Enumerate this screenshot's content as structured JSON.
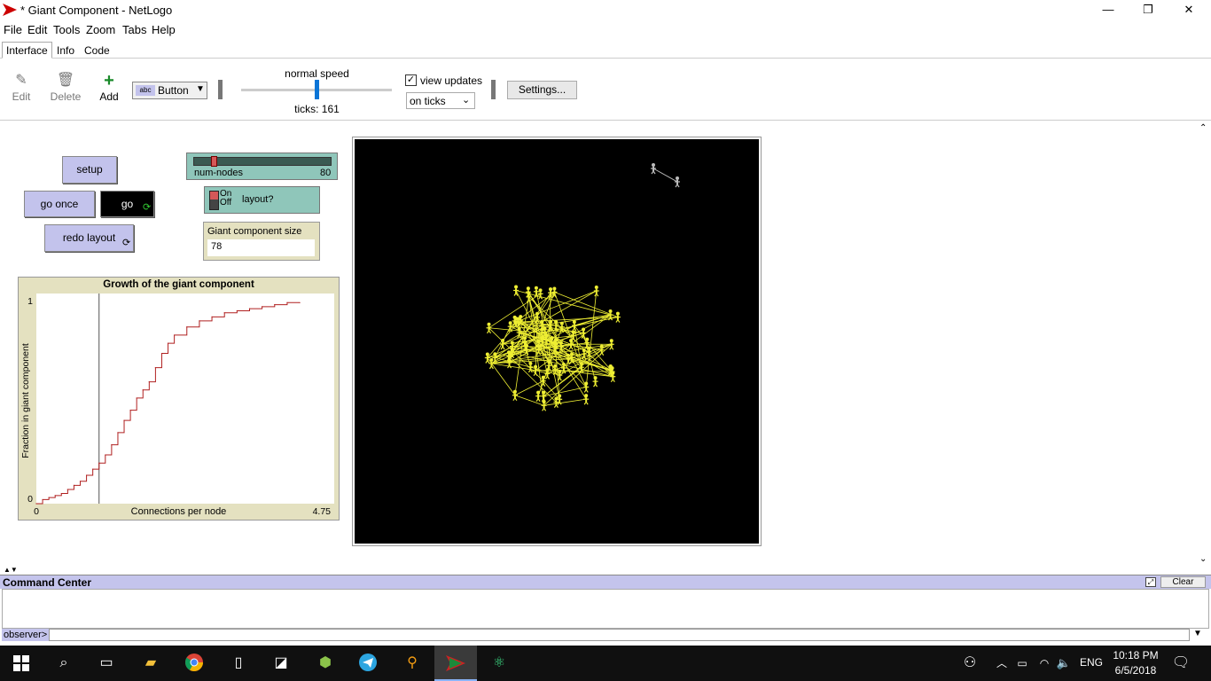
{
  "window": {
    "title": "* Giant Component - NetLogo",
    "minimize": "—",
    "restore": "❐",
    "close": "✕"
  },
  "menu": [
    "File",
    "Edit",
    "Tools",
    "Zoom",
    "Tabs",
    "Help"
  ],
  "tabs": [
    {
      "label": "Interface",
      "active": true
    },
    {
      "label": "Info",
      "active": false
    },
    {
      "label": "Code",
      "active": false
    }
  ],
  "toolbar": {
    "edit": "Edit",
    "delete": "Delete",
    "add": "Add",
    "widget_type": "Button",
    "widget_type_icon": "abc",
    "speed_label": "normal speed",
    "ticks_label": "ticks: 161",
    "speed_level": 0.5,
    "view_updates_label": "view updates",
    "view_updates_checked": true,
    "update_mode": "on ticks",
    "settings_label": "Settings..."
  },
  "widgets": {
    "setup": "setup",
    "go_once": "go once",
    "go": "go",
    "redo_layout": "redo layout",
    "slider": {
      "name": "num-nodes",
      "value": "80",
      "min": 2,
      "max": 500,
      "current": 80
    },
    "switch": {
      "on": "On",
      "off": "Off",
      "label": "layout?",
      "state": "off"
    },
    "monitor": {
      "label": "Giant component size",
      "value": "78"
    }
  },
  "chart_data": {
    "type": "line",
    "title": "Growth of the giant component",
    "xlabel": "Connections per node",
    "ylabel": "Fraction in giant component",
    "xlim": [
      0,
      4.75
    ],
    "ylim": [
      0,
      1
    ],
    "x_tick_labels": [
      "0",
      "4.75"
    ],
    "y_tick_labels": [
      "0",
      "1"
    ],
    "vertical_marker_x": 1.0,
    "series": [
      {
        "color": "#b02020",
        "points": [
          [
            0,
            0.0
          ],
          [
            0.1,
            0.02
          ],
          [
            0.2,
            0.03
          ],
          [
            0.3,
            0.04
          ],
          [
            0.4,
            0.05
          ],
          [
            0.5,
            0.07
          ],
          [
            0.6,
            0.09
          ],
          [
            0.7,
            0.11
          ],
          [
            0.8,
            0.14
          ],
          [
            0.9,
            0.17
          ],
          [
            1.0,
            0.2
          ],
          [
            1.1,
            0.24
          ],
          [
            1.2,
            0.29
          ],
          [
            1.3,
            0.35
          ],
          [
            1.4,
            0.41
          ],
          [
            1.5,
            0.46
          ],
          [
            1.6,
            0.52
          ],
          [
            1.7,
            0.56
          ],
          [
            1.8,
            0.6
          ],
          [
            1.9,
            0.67
          ],
          [
            2.0,
            0.74
          ],
          [
            2.1,
            0.79
          ],
          [
            2.2,
            0.83
          ],
          [
            2.4,
            0.87
          ],
          [
            2.6,
            0.9
          ],
          [
            2.8,
            0.92
          ],
          [
            3.0,
            0.94
          ],
          [
            3.2,
            0.95
          ],
          [
            3.4,
            0.96
          ],
          [
            3.6,
            0.97
          ],
          [
            3.8,
            0.98
          ],
          [
            4.0,
            0.99
          ],
          [
            4.2,
            0.99
          ]
        ]
      }
    ]
  },
  "command_center": {
    "title": "Command Center",
    "clear": "Clear",
    "prompt": "observer>"
  },
  "taskbar": {
    "time": "10:18 PM",
    "date": "6/5/2018",
    "lang": "ENG"
  },
  "colors": {
    "accent": "#0a74d6",
    "button": "#c3c3ec",
    "slider": "#8fc6ba",
    "monitor": "#e4e1c0",
    "view_bg": "#000000",
    "turtle": "#eeee33"
  }
}
